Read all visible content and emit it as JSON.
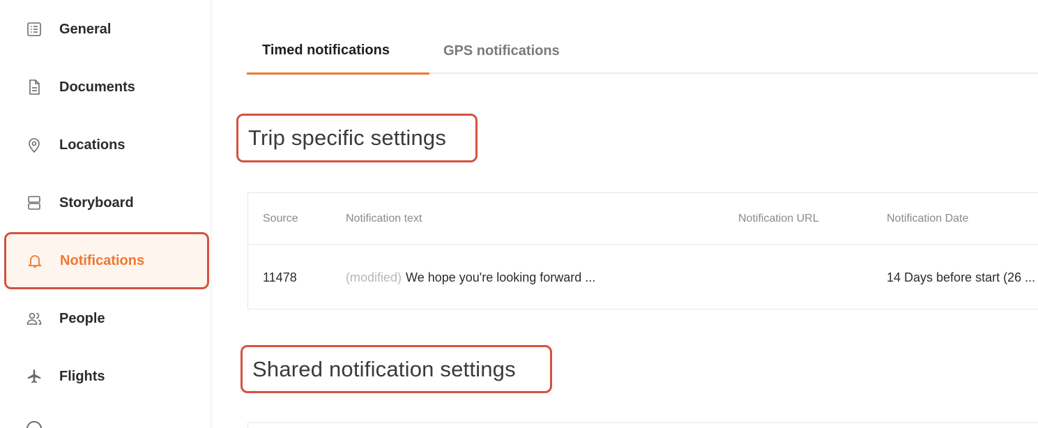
{
  "sidebar": {
    "items": [
      {
        "label": "General",
        "icon": "list-icon"
      },
      {
        "label": "Documents",
        "icon": "document-icon"
      },
      {
        "label": "Locations",
        "icon": "location-pin-icon"
      },
      {
        "label": "Storyboard",
        "icon": "storyboard-icon"
      },
      {
        "label": "Notifications",
        "icon": "bell-icon",
        "active": true
      },
      {
        "label": "People",
        "icon": "people-icon"
      },
      {
        "label": "Flights",
        "icon": "airplane-icon"
      }
    ]
  },
  "tabs": [
    {
      "label": "Timed notifications",
      "active": true
    },
    {
      "label": "GPS notifications",
      "active": false
    }
  ],
  "sections": {
    "trip": {
      "title": "Trip specific settings"
    },
    "shared": {
      "title": "Shared notification settings"
    }
  },
  "table": {
    "headers": [
      "Source",
      "Notification text",
      "Notification URL",
      "Notification Date"
    ],
    "rows": [
      {
        "source": "11478",
        "modified": "(modified)",
        "text": "We hope you're looking forward ...",
        "url": "",
        "date": "14 Days before start (26 ..."
      }
    ]
  },
  "colors": {
    "accent": "#f0772f",
    "highlight": "#d4523f"
  }
}
